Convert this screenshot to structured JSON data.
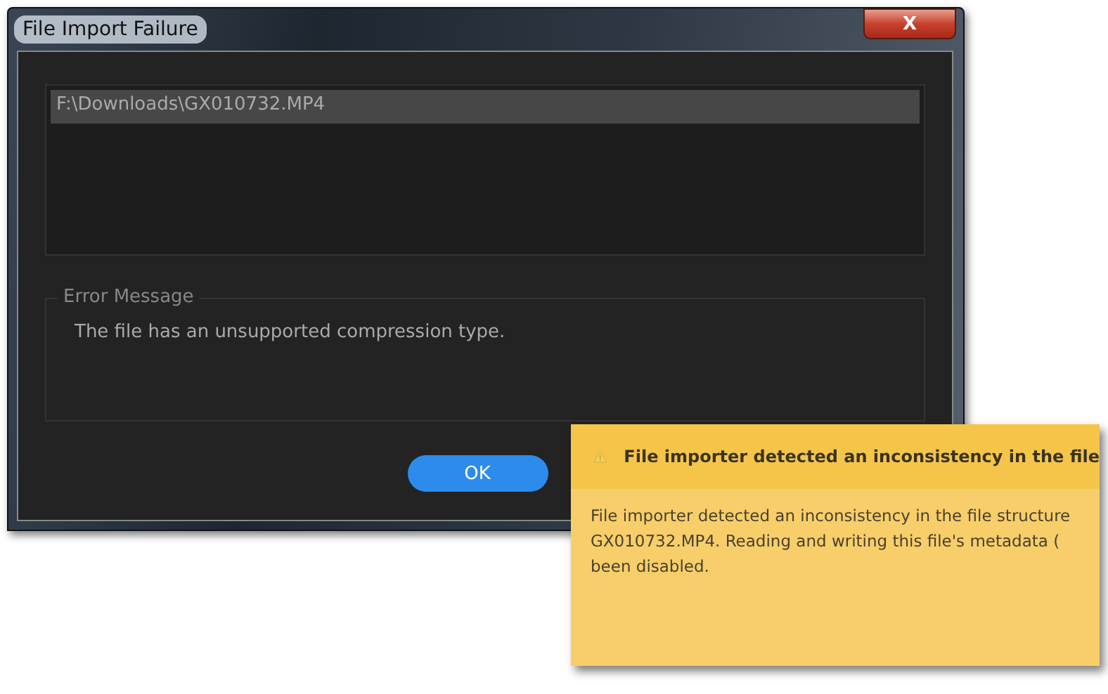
{
  "window": {
    "title": "File Import Failure",
    "close_label": "X"
  },
  "files": [
    {
      "path": "F:\\Downloads\\GX010732.MP4",
      "selected": true
    }
  ],
  "error_group": {
    "legend": "Error Message",
    "message": "The file has an unsupported compression type."
  },
  "buttons": [
    "OK"
  ],
  "notification": {
    "title": "File importer detected an inconsistency in the file",
    "lines": [
      "File importer detected an inconsistency in the file structure",
      "GX010732.MP4.  Reading and writing this file's metadata (",
      "been disabled."
    ]
  }
}
